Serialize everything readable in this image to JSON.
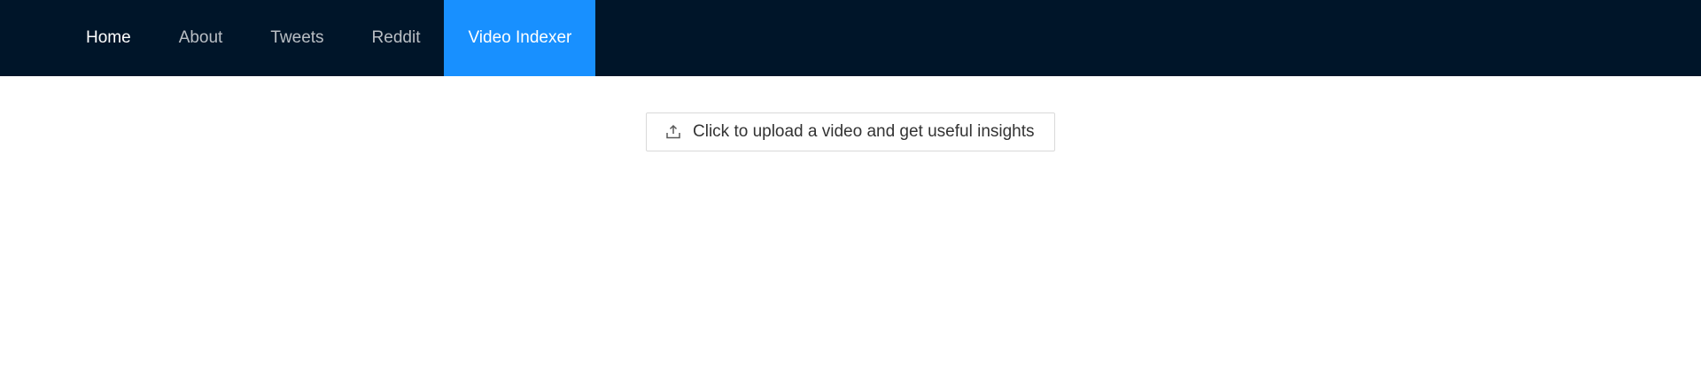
{
  "nav": {
    "items": [
      {
        "label": "Home"
      },
      {
        "label": "About"
      },
      {
        "label": "Tweets"
      },
      {
        "label": "Reddit"
      },
      {
        "label": "Video Indexer"
      }
    ],
    "active_index": 4
  },
  "upload": {
    "label": "Click to upload a video and get useful insights",
    "icon": "upload-icon"
  },
  "colors": {
    "nav_background": "#001529",
    "active_tab": "#1890ff",
    "page_background": "#ffffff",
    "button_border": "#d9d9d9"
  }
}
